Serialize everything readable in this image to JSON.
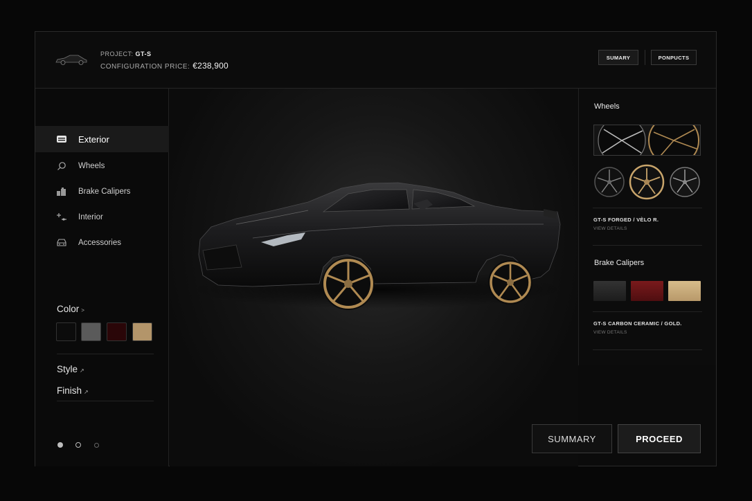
{
  "header": {
    "project_label": "PROJECT:",
    "project_name": "GT-S",
    "price_label": "CONFIGURATION PRICE:",
    "price_value": "€238,900",
    "summary_button": "SUMARY",
    "products_button": "PONPUCTS"
  },
  "sidebar": {
    "items": [
      {
        "label": "Exterior",
        "icon": "car-body-icon",
        "active": true
      },
      {
        "label": "Wheels",
        "icon": "search-icon",
        "active": false
      },
      {
        "label": "Brake Calipers",
        "icon": "caliper-icon",
        "active": false
      },
      {
        "label": "Interior",
        "icon": "seat-adjust-icon",
        "active": false
      },
      {
        "label": "Accessories",
        "icon": "car-front-icon",
        "active": false
      }
    ],
    "color_label": "Color",
    "color_swatches": [
      "#0c0c0c",
      "#5a5a5a",
      "#2a0608",
      "#b3956a"
    ],
    "style_label": "Style",
    "finish_label": "Finish",
    "arrow": ">",
    "arrow_small": "↗",
    "pagination": {
      "current": 2,
      "total": 3
    }
  },
  "stage": {
    "summary_button": "SUMMARY",
    "proceed_button": "PROCEED"
  },
  "right_panel": {
    "wheels_title": "Wheels",
    "wheel_selected": "GT-S FORGED / VÈLO R.",
    "wheel_details": "VIEW DETAILS",
    "brake_title": "Brake Calipers",
    "caliper_colors": [
      "#2a2a2a",
      "#6a1416",
      "#c9ad7c"
    ],
    "caliper_selected": "GT-S CARBON CERAMIC / GOLD.",
    "caliper_details": "VIEW DETAILS"
  },
  "colors": {
    "accent_gold": "#b08a52",
    "background": "#0b0b0b"
  }
}
